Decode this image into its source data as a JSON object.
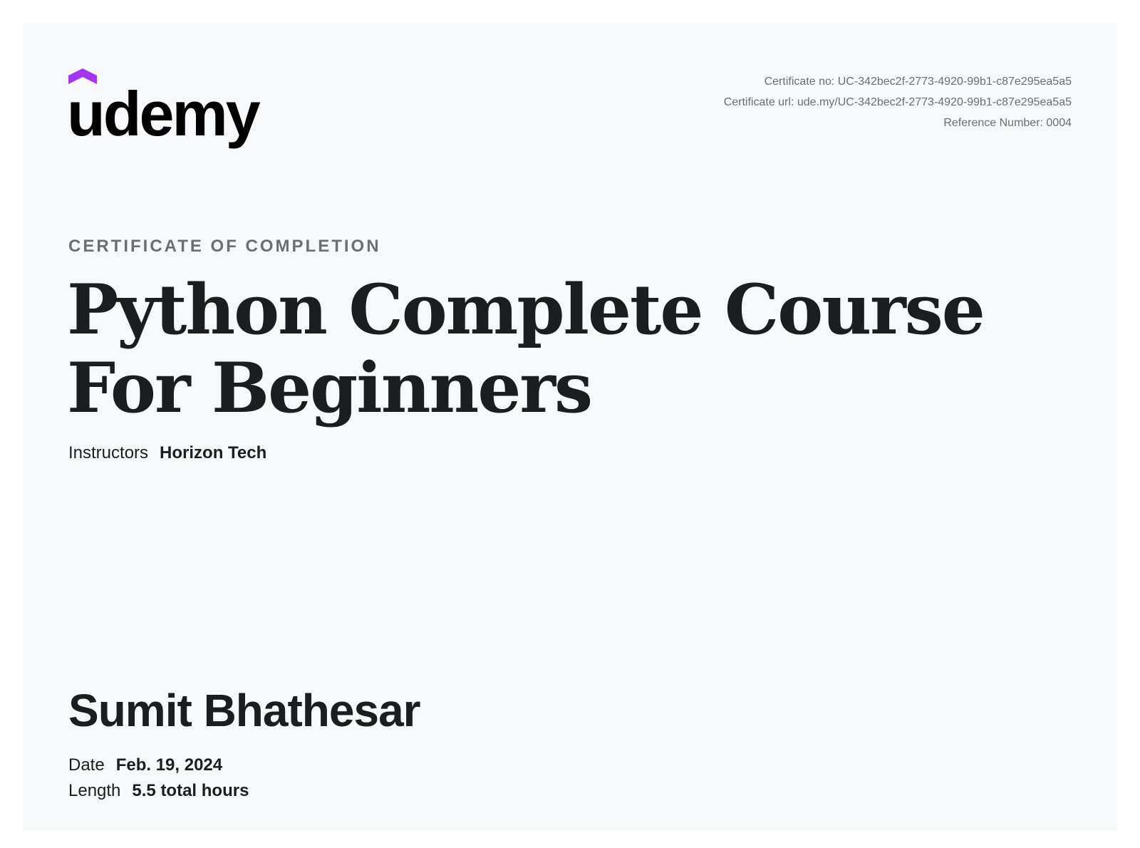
{
  "brand": {
    "logo_text": "udemy",
    "accent_color": "#a435f0"
  },
  "meta": {
    "certificate_no": "Certificate no: UC-342bec2f-2773-4920-99b1-c87e295ea5a5",
    "certificate_url": "Certificate url: ude.my/UC-342bec2f-2773-4920-99b1-c87e295ea5a5",
    "reference_number": "Reference Number: 0004"
  },
  "certificate": {
    "eyebrow": "CERTIFICATE OF COMPLETION",
    "course_title": "Python Complete Course For Beginners",
    "instructors_label": "Instructors",
    "instructors_value": "Horizon Tech",
    "student_name": "Sumit Bhathesar",
    "date_label": "Date",
    "date_value": "Feb. 19, 2024",
    "length_label": "Length",
    "length_value": "5.5 total hours"
  }
}
